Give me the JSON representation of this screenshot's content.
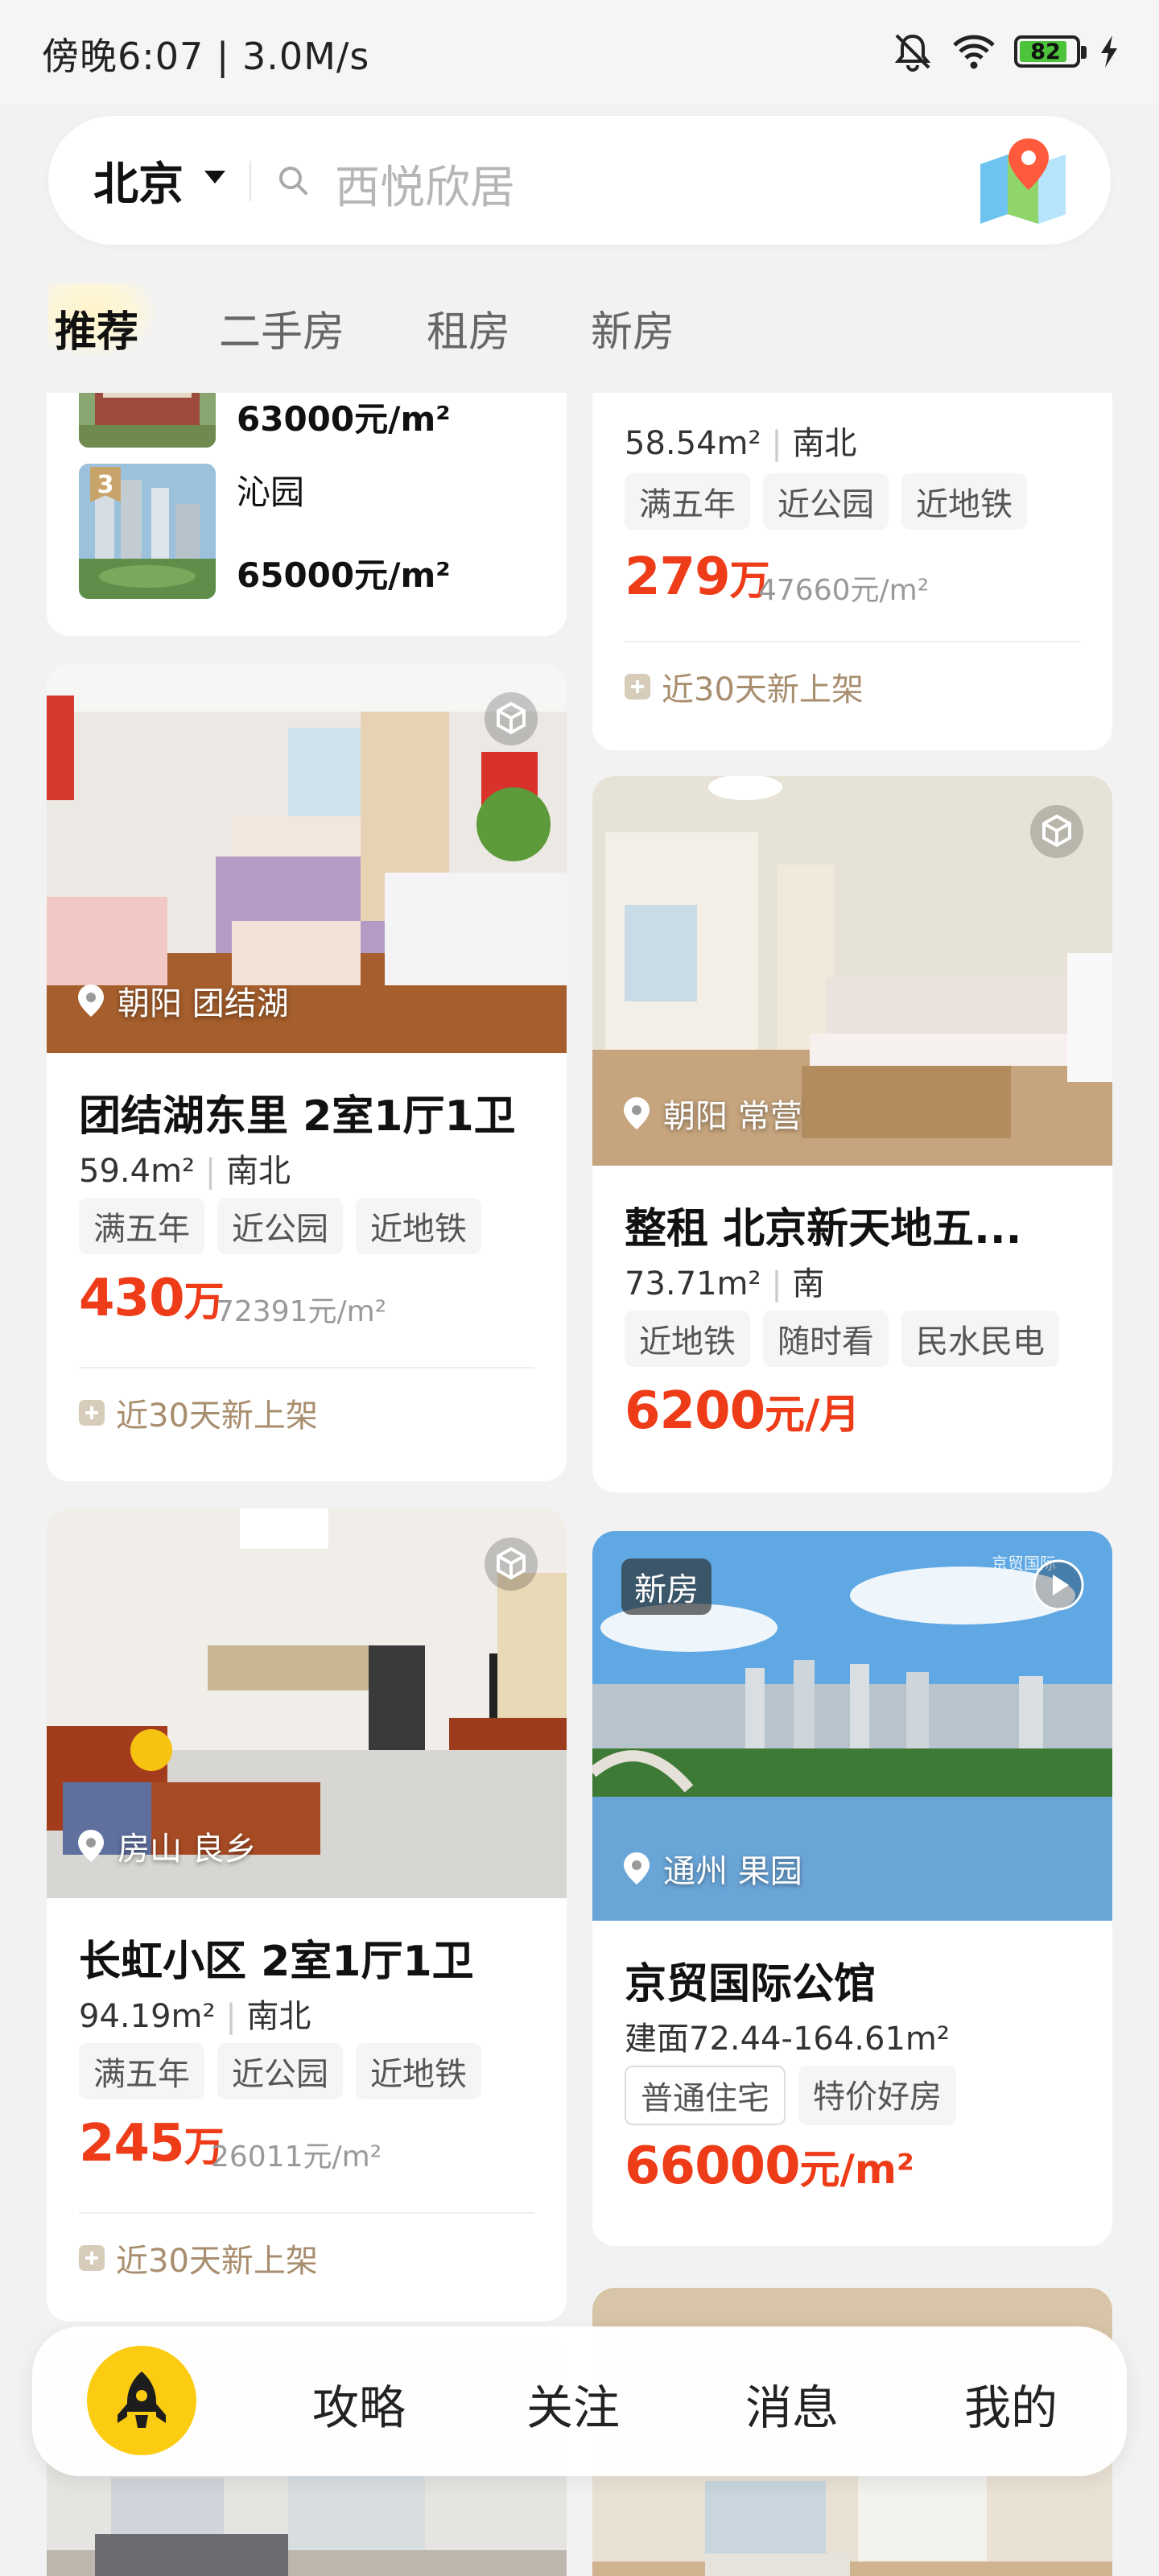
{
  "status_bar": {
    "time_speed": "傍晚6:07 | 3.0M/s",
    "battery": "82"
  },
  "search": {
    "city": "北京",
    "placeholder": "西悦欣居"
  },
  "tabs": [
    {
      "label": "推荐",
      "active": true
    },
    {
      "label": "二手房"
    },
    {
      "label": "租房"
    },
    {
      "label": "新房"
    }
  ],
  "ranking_card": {
    "item1_price": "63000元/m²",
    "item2_rank": "3",
    "item2_name": "沁园",
    "item2_price": "65000元/m²"
  },
  "cards": {
    "top_right": {
      "area": "58.54m²",
      "orientation": "南北",
      "tags": [
        "满五年",
        "近公园",
        "近地铁"
      ],
      "price": "279",
      "price_unit": "万",
      "price_per": "47660元/m²",
      "new_label": "近30天新上架"
    },
    "c1": {
      "location": "朝阳 团结湖",
      "title": "团结湖东里 2室1厅1卫",
      "area": "59.4m²",
      "orientation": "南北",
      "tags": [
        "满五年",
        "近公园",
        "近地铁"
      ],
      "price": "430",
      "price_unit": "万",
      "price_per": "72391元/m²",
      "new_label": "近30天新上架"
    },
    "c2": {
      "location": "朝阳 常营",
      "title": "整租 北京新天地五...",
      "area": "73.71m²",
      "orientation": "南",
      "tags": [
        "近地铁",
        "随时看",
        "民水民电"
      ],
      "price": "6200",
      "price_unit": "元/月"
    },
    "c3": {
      "location": "房山 良乡",
      "title": "长虹小区 2室1厅1卫",
      "area": "94.19m²",
      "orientation": "南北",
      "tags": [
        "满五年",
        "近公园",
        "近地铁"
      ],
      "price": "245",
      "price_unit": "万",
      "price_per": "26011元/m²",
      "new_label": "近30天新上架"
    },
    "c4": {
      "badge": "新房",
      "watermark": "京贸国际",
      "location": "通州 果园",
      "title": "京贸国际公馆",
      "area": "建面72.44-164.61m²",
      "tags": [
        "普通住宅",
        "特价好房"
      ],
      "price": "66000",
      "price_unit": "元/m²"
    }
  },
  "bottom_nav": [
    {
      "label": "攻略"
    },
    {
      "label": "关注"
    },
    {
      "label": "消息"
    },
    {
      "label": "我的"
    }
  ],
  "colors": {
    "price": "#ee3c19",
    "accent": "#fccc13",
    "new_listing": "#a88e6e"
  }
}
